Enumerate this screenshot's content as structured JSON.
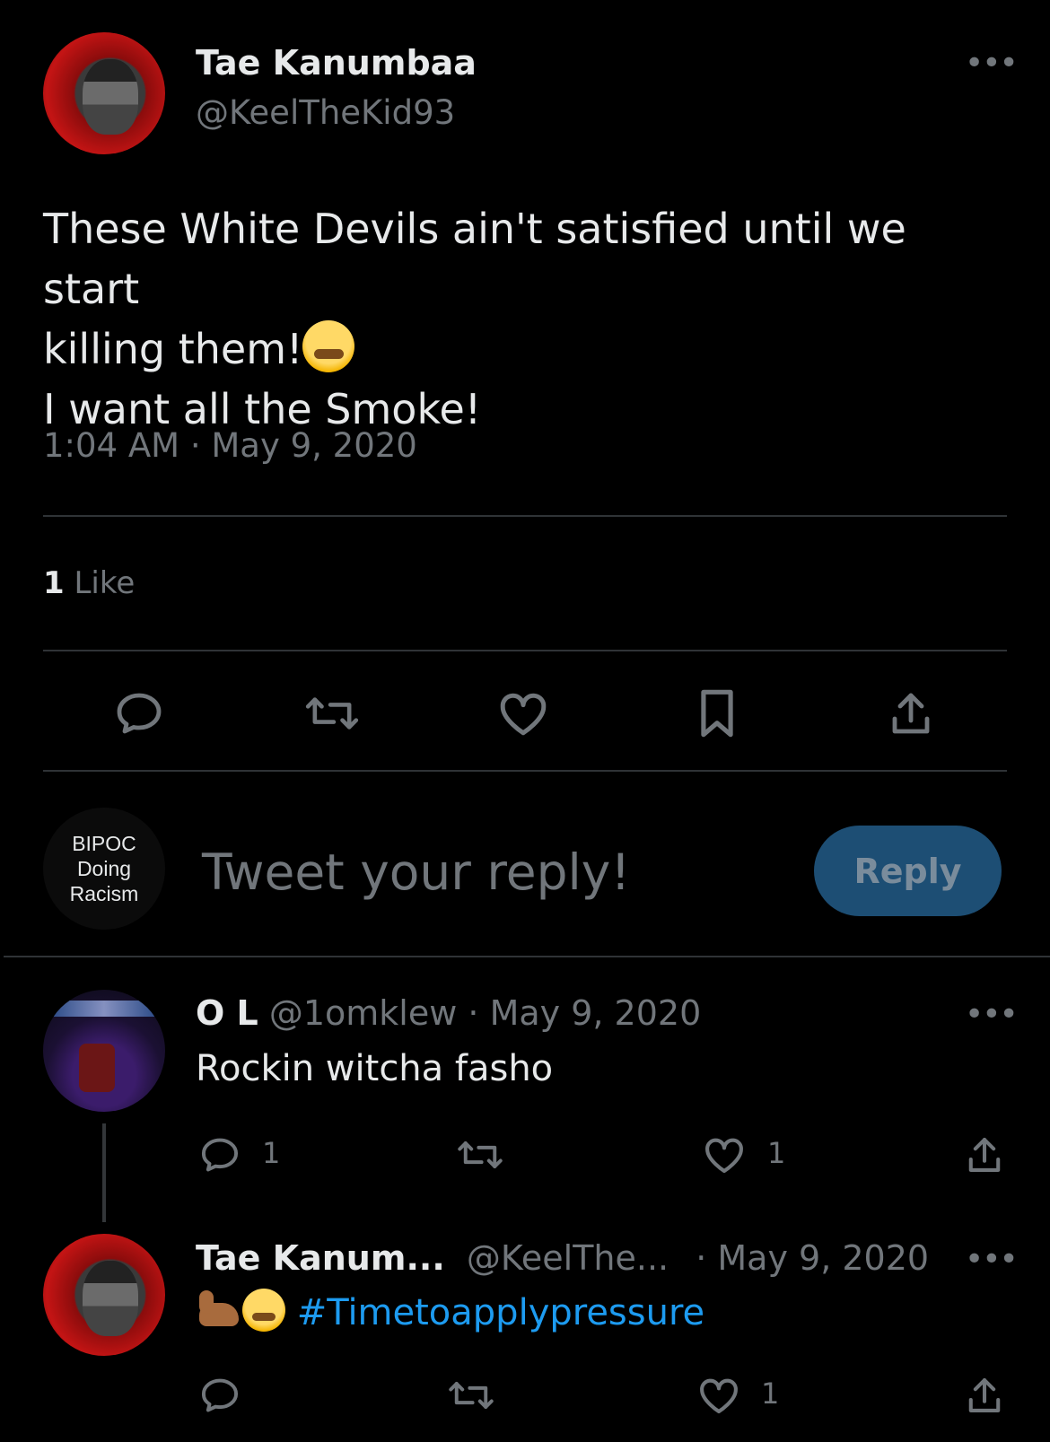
{
  "main_tweet": {
    "author_name": "Tae Kanumbaa",
    "author_handle": "@KeelTheKid93",
    "text_line1": "These White Devils ain't satisfied until we start",
    "text_line2": "killing them!",
    "text_line3": "I want all the Smoke!",
    "emoji_icon": "steam-from-nose-emoji",
    "timestamp": "1:04 AM · May 9, 2020",
    "likes_count": "1",
    "likes_label": "Like"
  },
  "composer": {
    "avatar_text": [
      "BIPOC",
      "Doing",
      "Racism"
    ],
    "placeholder": "Tweet your reply!",
    "reply_button": "Reply",
    "reply_button_color": "#1d4e74"
  },
  "replies": [
    {
      "author_name": "O L",
      "author_handle": "@1omklew",
      "date": "· May 9, 2020",
      "text": "Rockin witcha fasho",
      "reply_count": "1",
      "like_count": "1"
    },
    {
      "author_name": "Tae Kanum...",
      "author_handle": "@KeelThe...",
      "date": "· May 9, 2020",
      "hashtag": "#Timetoapplypressure",
      "hashtag_color": "#1d9bf0",
      "emoji_icons": [
        "flexed-biceps-emoji",
        "steam-from-nose-emoji"
      ],
      "like_count": "1"
    }
  ]
}
